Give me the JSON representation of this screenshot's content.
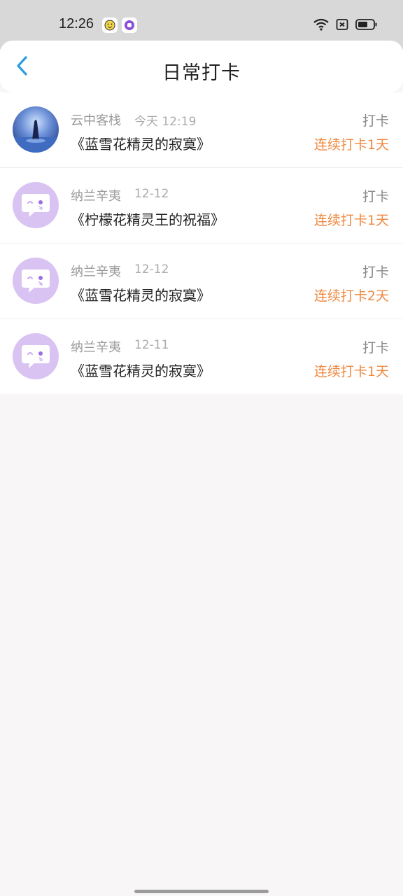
{
  "status_bar": {
    "time": "12:26",
    "app_icons": [
      "smile-app-icon",
      "purple-app-icon"
    ],
    "indicators": [
      "wifi-icon",
      "sim-blocked-icon",
      "battery-icon"
    ]
  },
  "header": {
    "back_icon": "chevron-left-icon",
    "title": "日常打卡"
  },
  "records": [
    {
      "user": "云中客栈",
      "time": "今天 12:19",
      "book": "《蓝雪花精灵的寂寞》",
      "action": "打卡",
      "streak": "连续打卡1天",
      "avatar": "photo-avatar"
    },
    {
      "user": "纳兰辛夷",
      "time": "12-12",
      "book": "《柠檬花精灵王的祝福》",
      "action": "打卡",
      "streak": "连续打卡1天",
      "avatar": "default-avatar"
    },
    {
      "user": "纳兰辛夷",
      "time": "12-12",
      "book": "《蓝雪花精灵的寂寞》",
      "action": "打卡",
      "streak": "连续打卡2天",
      "avatar": "default-avatar"
    },
    {
      "user": "纳兰辛夷",
      "time": "12-11",
      "book": "《蓝雪花精灵的寂寞》",
      "action": "打卡",
      "streak": "连续打卡1天",
      "avatar": "default-avatar"
    }
  ],
  "colors": {
    "accent": "#2b9de0",
    "streak": "#f0883e",
    "default_avatar": "#d9c3f2"
  }
}
